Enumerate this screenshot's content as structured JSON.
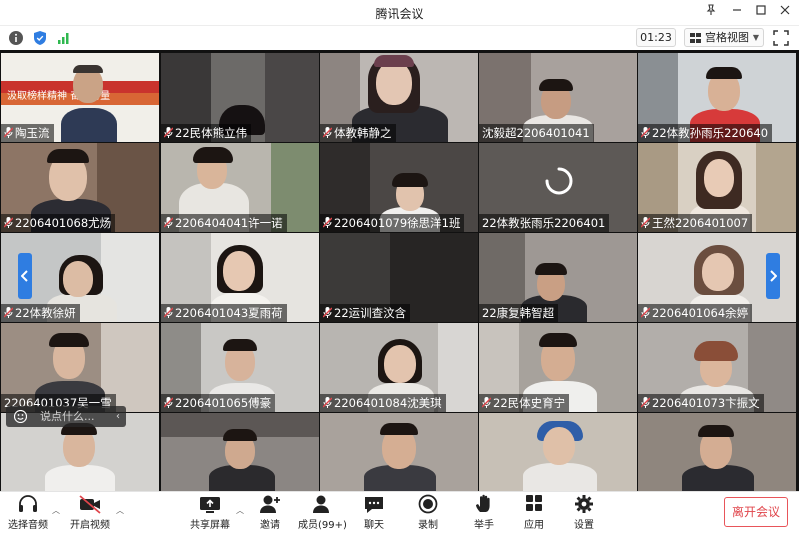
{
  "window": {
    "title": "腾讯会议"
  },
  "infobar": {
    "timer": "01:23",
    "view_label": "宫格视图"
  },
  "participants": [
    "陶玉流",
    "22民体熊立伟",
    "体教韩静之",
    "沈毅超2206401041",
    "22体教孙雨乐220640",
    "2206401068尤炀",
    "2206404041许一诺",
    "2206401079徐思洋1班",
    "22体教张雨乐2206401",
    "王然2206401007",
    "22体教徐妍",
    "2206401043夏雨荷",
    "22运训查汶含",
    "22康复韩智超",
    "2206401064余婷",
    "2206401037吴一雪",
    "2206401065傅豪",
    "2206401084沈美琪",
    "22民体史育宁",
    "2206401073卞振文"
  ],
  "first_tile_banner": "汲取榜样精神 奋进力量",
  "chat": {
    "placeholder": "说点什么..."
  },
  "toolbar": {
    "audio": "选择音频",
    "video": "开启视频",
    "share": "共享屏幕",
    "invite": "邀请",
    "members": "成员(99+)",
    "chat": "聊天",
    "record": "录制",
    "raise_hand": "举手",
    "apps": "应用",
    "settings": "设置",
    "leave": "离开会议"
  },
  "colors": {
    "accent": "#2f7de1",
    "danger": "#e0454b",
    "signal": "#2fb84f"
  }
}
